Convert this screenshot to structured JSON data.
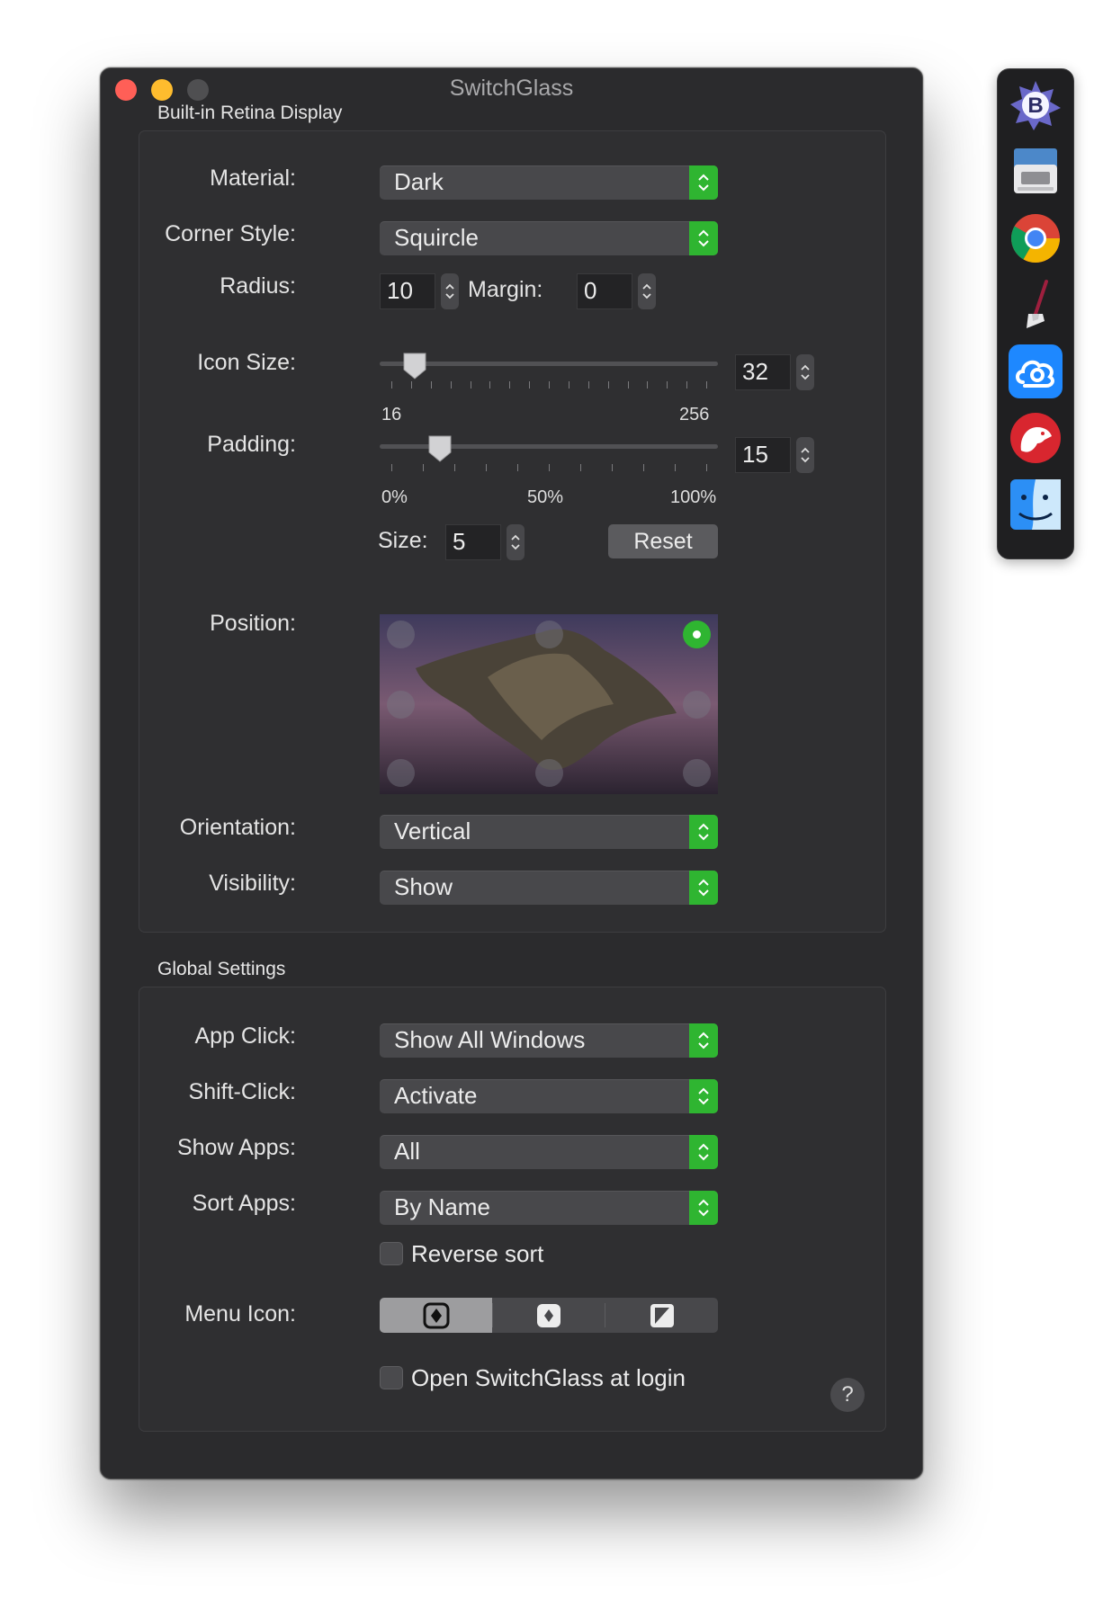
{
  "window": {
    "title": "SwitchGlass"
  },
  "display_section": {
    "label": "Built-in Retina Display",
    "material": {
      "label": "Material:",
      "value": "Dark"
    },
    "corner_style": {
      "label": "Corner Style:",
      "value": "Squircle"
    },
    "radius": {
      "label": "Radius:",
      "value": "10"
    },
    "margin": {
      "label": "Margin:",
      "value": "0"
    },
    "icon_size": {
      "label": "Icon Size:",
      "min_label": "16",
      "max_label": "256",
      "value": "32",
      "slider_fraction": 0.07
    },
    "padding": {
      "label": "Padding:",
      "min_label": "0%",
      "mid_label": "50%",
      "max_label": "100%",
      "value": "15",
      "slider_fraction": 0.15
    },
    "size": {
      "label": "Size:",
      "value": "5"
    },
    "reset_label": "Reset",
    "position": {
      "label": "Position:",
      "selected": "top-right"
    },
    "orientation": {
      "label": "Orientation:",
      "value": "Vertical"
    },
    "visibility": {
      "label": "Visibility:",
      "value": "Show"
    }
  },
  "global_section": {
    "label": "Global Settings",
    "app_click": {
      "label": "App Click:",
      "value": "Show All Windows"
    },
    "shift_click": {
      "label": "Shift-Click:",
      "value": "Activate"
    },
    "show_apps": {
      "label": "Show Apps:",
      "value": "All"
    },
    "sort_apps": {
      "label": "Sort Apps:",
      "value": "By Name"
    },
    "reverse_sort": {
      "label": "Reverse sort",
      "checked": false
    },
    "menu_icon": {
      "label": "Menu Icon:",
      "options": [
        "squircle-diamond-icon",
        "diamond-icon",
        "half-square-icon"
      ],
      "selected_index": 0
    },
    "open_at_login": {
      "label": "Open SwitchGlass at login",
      "checked": false
    },
    "help_label": "?"
  },
  "dock": {
    "apps": [
      "bbedit-icon",
      "printer-icon",
      "chrome-icon",
      "broom-icon",
      "cloud-app-icon",
      "bear-icon",
      "finder-icon"
    ]
  },
  "colors": {
    "accent": "#2fb531",
    "window_bg": "#2b2b2d",
    "close": "#ff5f57",
    "minimize": "#febc2e"
  }
}
